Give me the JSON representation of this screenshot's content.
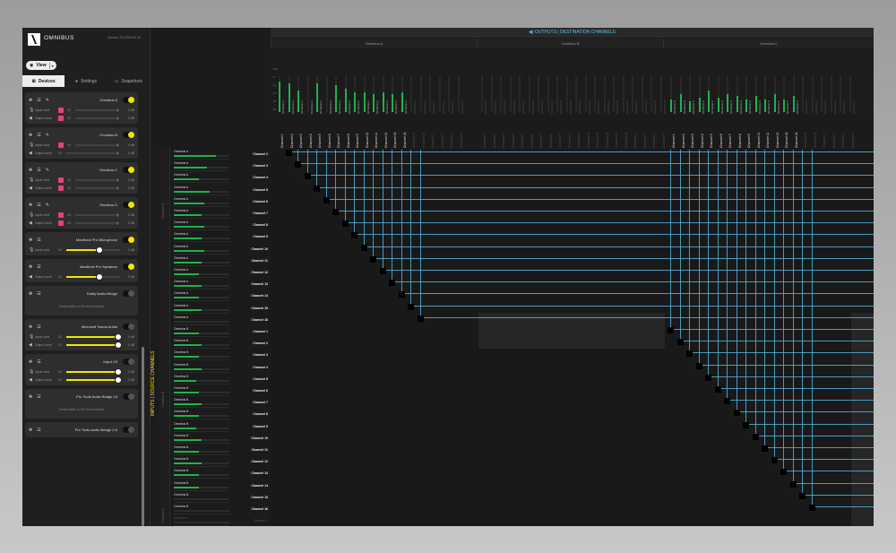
{
  "app": {
    "name": "OMNIBUS",
    "version": "Version: 2.0.2023.09.19"
  },
  "toolbar": {
    "view_label": "View"
  },
  "tabs": [
    {
      "label": "Devices",
      "icon": "devices-icon",
      "active": true
    },
    {
      "label": "Settings",
      "icon": "gear-icon",
      "active": false
    },
    {
      "label": "Snapshots",
      "icon": "snapshot-icon",
      "active": false
    }
  ],
  "labels": {
    "input_level": "Input Level",
    "output_level": "Output Level",
    "zero_db": "0 dB",
    "ten": "10",
    "outputs_header": "OUTPUTS | DESTINATION CHANNELS",
    "inputs_header": "INPUTS | SOURCE CHANNELS",
    "omnibus_c": "Omnibus C"
  },
  "devices": [
    {
      "name": "Omnibus A",
      "enabled": true,
      "editable": true,
      "rows": [
        {
          "type": "input",
          "label": "Input Level",
          "mute": true,
          "level": 0.95,
          "db": "0 dB",
          "num": "10"
        },
        {
          "type": "output",
          "label": "Output Level",
          "mute": true,
          "level": 0.95,
          "db": "0 dB",
          "num": "10"
        }
      ]
    },
    {
      "name": "Omnibus B",
      "enabled": true,
      "editable": true,
      "rows": [
        {
          "type": "input",
          "label": "Input Level",
          "mute": true,
          "level": 0.95,
          "db": "0 dB",
          "num": "10"
        },
        {
          "type": "output",
          "label": "Output Level",
          "mute": false,
          "level": 0.95,
          "db": "0 dB",
          "num": "10"
        }
      ]
    },
    {
      "name": "Omnibus C",
      "enabled": true,
      "editable": true,
      "rows": [
        {
          "type": "input",
          "label": "Input Level",
          "mute": true,
          "level": 0.95,
          "db": "0 dB",
          "num": "10"
        },
        {
          "type": "output",
          "label": "Output Level",
          "mute": true,
          "level": 0.95,
          "db": "0 dB",
          "num": "10"
        }
      ]
    },
    {
      "name": "Omnibus D",
      "enabled": true,
      "editable": true,
      "rows": [
        {
          "type": "input",
          "label": "Input Level",
          "mute": true,
          "level": 0.95,
          "db": "0 dB",
          "num": "10"
        },
        {
          "type": "output",
          "label": "Output Level",
          "mute": true,
          "level": 0.95,
          "db": "0 dB",
          "num": "10"
        }
      ]
    },
    {
      "name": "MacBook Pro Microphone",
      "enabled": true,
      "editable": false,
      "rows": [
        {
          "type": "input",
          "label": "Input Level",
          "mute": false,
          "level": 0.6,
          "db": "0 dB",
          "num": "10",
          "active": true
        }
      ]
    },
    {
      "name": "MacBook Pro Speakers",
      "enabled": true,
      "editable": false,
      "rows": [
        {
          "type": "output",
          "label": "Output Level",
          "mute": false,
          "level": 0.6,
          "db": "0 dB",
          "num": "10",
          "active": true
        }
      ]
    },
    {
      "name": "Dolby Audio Bridge",
      "enabled": false,
      "editable": false,
      "rows": [],
      "note": "Device with no I/O level controls"
    },
    {
      "name": "Microsoft Teams Audio",
      "enabled": false,
      "editable": false,
      "rows": [
        {
          "type": "input",
          "label": "Input Level",
          "mute": false,
          "level": 0.95,
          "db": "0 dB",
          "num": "10",
          "active": true
        },
        {
          "type": "output",
          "label": "Output Level",
          "mute": false,
          "level": 0.95,
          "db": "0 dB",
          "num": "10",
          "active": true
        }
      ]
    },
    {
      "name": "Inject X3",
      "enabled": false,
      "editable": false,
      "rows": [
        {
          "type": "input",
          "label": "Input Level",
          "mute": false,
          "level": 0.95,
          "db": "0 dB",
          "num": "10",
          "active": true
        },
        {
          "type": "output",
          "label": "Output Level",
          "mute": false,
          "level": 0.95,
          "db": "0 dB",
          "num": "10",
          "active": true
        }
      ]
    },
    {
      "name": "Pro Tools Audio Bridge 16",
      "enabled": false,
      "editable": false,
      "rows": [],
      "note": "Device with no I/O level controls"
    },
    {
      "name": "Pro Tools Audio Bridge 2 A",
      "enabled": false,
      "editable": false,
      "rows": []
    }
  ],
  "output_groups": [
    "Omnibus A",
    "Omnibus B",
    "Omnibus C"
  ],
  "output_columns_a": [
    "Omnibus A",
    "Omnibus A",
    "Omnibus A",
    "Omnibus A",
    "Omnibus A",
    "Omnibus A",
    "Omnibus A",
    "Omnibus A",
    "Omnibus A",
    "Omnibus A",
    "Omnibus A",
    "Omnibus A",
    "Omnibus A",
    "Omnibus A",
    "Omnibus A",
    "Omnibus A"
  ],
  "output_levels_a": [
    0.85,
    0.8,
    0.6,
    0.0,
    0.8,
    0.0,
    0.75,
    0.65,
    0.55,
    0.55,
    0.5,
    0.55,
    0.5,
    0.55,
    0.0,
    0.0
  ],
  "output_levels_b": [
    0,
    0,
    0,
    0,
    0,
    0,
    0,
    0,
    0,
    0,
    0,
    0,
    0,
    0,
    0,
    0
  ],
  "output_levels_c": [
    0.35,
    0.5,
    0.3,
    0.4,
    0.6,
    0.4,
    0.5,
    0.45,
    0.35,
    0.45,
    0.35,
    0.5,
    0.35,
    0.45,
    0.0,
    0.0
  ],
  "scale": [
    "0 dB",
    "-6",
    "-12",
    "-18",
    "-30",
    "-60"
  ],
  "channels": [
    "Channel 1",
    "Channel 2",
    "Channel 3",
    "Channel 4",
    "Channel 5",
    "Channel 6",
    "Channel 7",
    "Channel 8",
    "Channel 9",
    "Channel 10",
    "Channel 11",
    "Channel 12",
    "Channel 13",
    "Channel 14",
    "Channel 15",
    "Channel 16"
  ],
  "inputs_a_levels": [
    0.75,
    0.6,
    0.45,
    0.65,
    0.55,
    0.5,
    0.55,
    0.5,
    0.55,
    0.5,
    0.45,
    0.5,
    0.45,
    0.5,
    0.0,
    0.0
  ],
  "inputs_b_levels": [
    0.45,
    0.5,
    0.45,
    0.5,
    0.4,
    0.45,
    0.5,
    0.45,
    0.4,
    0.5,
    0.45,
    0.5,
    0.45,
    0.45,
    0.0,
    0.0
  ],
  "input_group_names": [
    "Omnibus A",
    "Omnibus B",
    "Omnibus C"
  ],
  "row_labels_a": [
    "Channel 2",
    "Channel 3",
    "Channel 4",
    "Channel 5",
    "Channel 6",
    "Channel 7",
    "Channel 8",
    "Channel 9",
    "Channel 10",
    "Channel 11",
    "Channel 12",
    "Channel 13",
    "Channel 14",
    "Channel 15",
    "Channel 16"
  ],
  "row_labels_b": [
    "Channel 1",
    "Channel 2",
    "Channel 3",
    "Channel 4",
    "Channel 5",
    "Channel 6",
    "Channel 7",
    "Channel 8",
    "Channel 9",
    "Channel 10",
    "Channel 11",
    "Channel 12",
    "Channel 13",
    "Channel 14",
    "Channel 15",
    "Channel 16"
  ],
  "row_labels_c": [
    "Channel 1",
    "Channel 2"
  ]
}
